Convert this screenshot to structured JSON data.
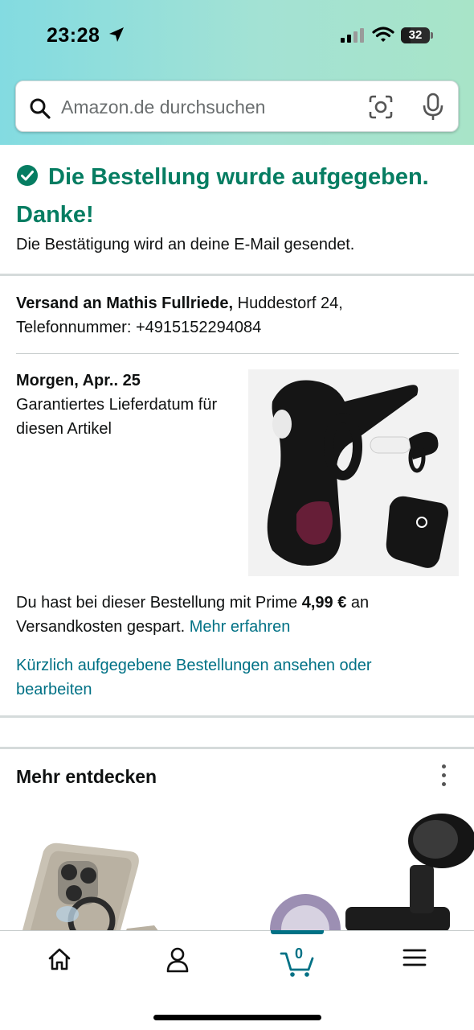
{
  "status_bar": {
    "time": "23:28",
    "battery": "32"
  },
  "search": {
    "placeholder": "Amazon.de durchsuchen"
  },
  "confirmation": {
    "title": "Die Bestellung wurde aufgegeben. Danke!",
    "subtitle": "Die Bestätigung wird an deine E-Mail gesendet."
  },
  "shipping": {
    "label": "Versand an Mathis Fullriede,",
    "address": " Huddestorf 24, Telefonnummer: +4915152294084"
  },
  "delivery": {
    "date": "Morgen, Apr.. 25",
    "note": "Garantiertes Lieferdatum für diesen Artikel"
  },
  "prime": {
    "text_before": "Du hast bei dieser Bestellung mit Prime ",
    "amount": "4,99 €",
    "text_after": " an Versandkosten gespart. ",
    "link": "Mehr erfahren"
  },
  "orders_link": "Kürzlich aufgegebene Bestellungen ansehen oder bearbeiten",
  "discover": {
    "title": "Mehr entdecken"
  },
  "tabbar": {
    "cart_count": "0"
  },
  "colors": {
    "success": "#067d62",
    "link": "#007185",
    "tab_active": "#007185"
  },
  "icons": [
    "location-arrow-icon",
    "cell-signal-icon",
    "wifi-icon",
    "battery-icon",
    "search-icon",
    "camera-scan-icon",
    "microphone-icon",
    "check-circle-icon",
    "more-vertical-icon",
    "home-icon",
    "account-icon",
    "cart-icon",
    "menu-icon"
  ]
}
